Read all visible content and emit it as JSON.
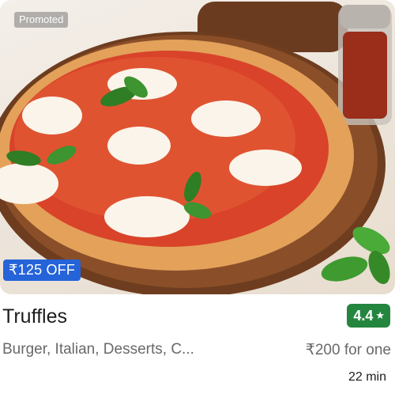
{
  "badges": {
    "promoted": "Promoted",
    "offer": "₹125 OFF"
  },
  "restaurant": {
    "name": "Truffles",
    "rating": "4.4",
    "rating_icon": "star-icon",
    "cuisines": "Burger, Italian, Desserts, C...",
    "price": "₹200 for one",
    "delivery_time": "22 min"
  },
  "image": {
    "subject": "pizza-photo"
  },
  "colors": {
    "offer_badge": "#2563d9",
    "rating_badge": "#24853f"
  }
}
